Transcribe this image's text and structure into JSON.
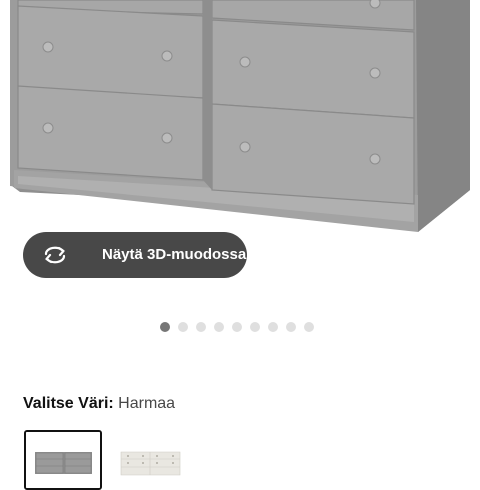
{
  "product_view": {
    "image_alt": "gray chest of drawers",
    "view_3d_label": "Näytä 3D-muodossa",
    "view_3d_icon": "rotate-arrows-icon",
    "carousel": {
      "count": 9,
      "active_index": 0
    }
  },
  "color_selector": {
    "label": "Valitse Väri:",
    "value": "Harmaa",
    "options": [
      {
        "name": "gray",
        "color": "#8e8e8e",
        "selected": true
      },
      {
        "name": "white",
        "color": "#f2f0ea",
        "selected": false
      }
    ]
  },
  "colors": {
    "button_bg": "#484848",
    "dresser_gray": "#a2a2a2",
    "dot_active": "#767676",
    "dot_inactive": "#dfdfdf"
  }
}
